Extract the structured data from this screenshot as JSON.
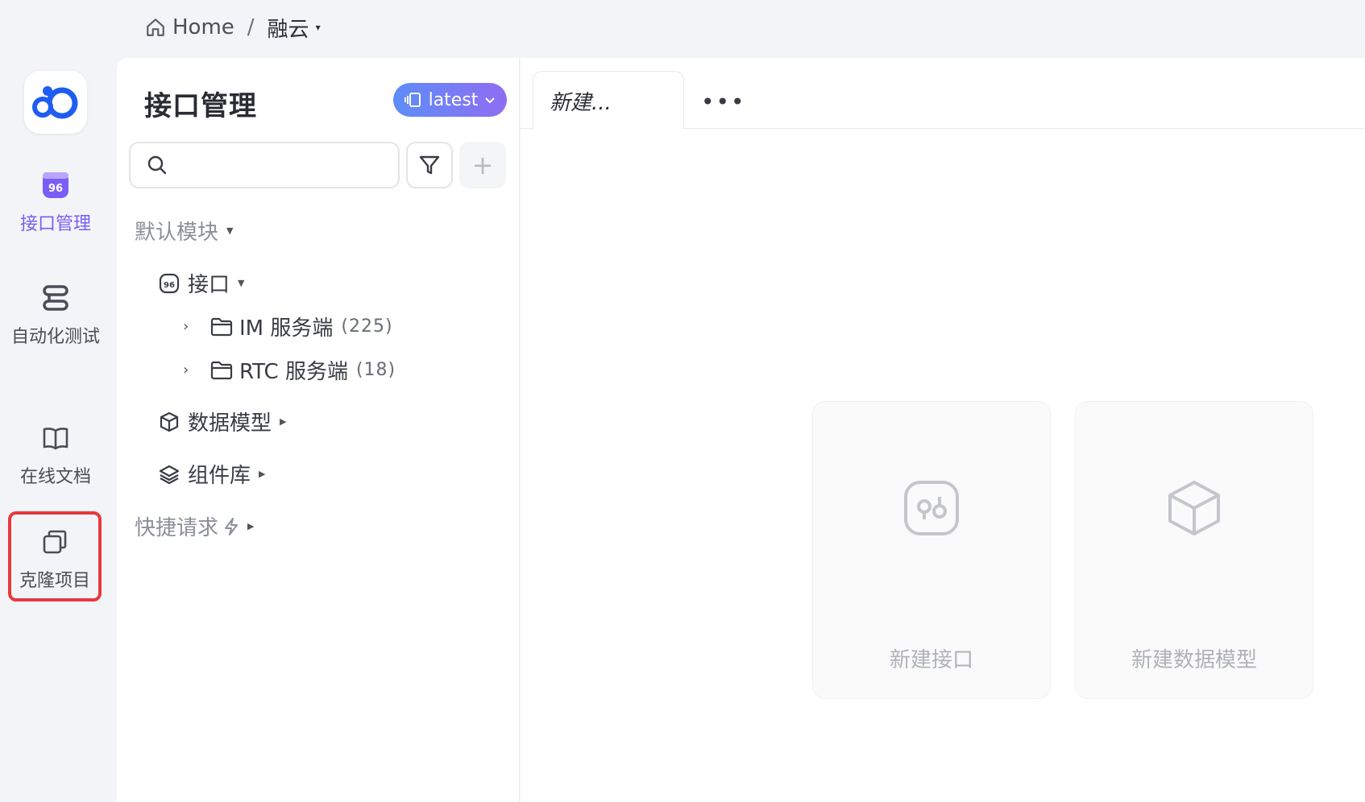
{
  "breadcrumb": {
    "home": "Home",
    "separator": "/",
    "project": "融云",
    "caret": "▾"
  },
  "rail": {
    "items": [
      {
        "label": "接口管理",
        "icon": "api-icon"
      },
      {
        "label": "自动化测试",
        "icon": "server-stack-icon"
      },
      {
        "label": "在线文档",
        "icon": "book-icon"
      },
      {
        "label": "克隆项目",
        "icon": "copy-icon"
      }
    ]
  },
  "panel": {
    "title": "接口管理",
    "version": "latest",
    "search_placeholder": "",
    "add_label": "+",
    "tree": {
      "default_module": "默认模块",
      "api": "接口",
      "folders": [
        {
          "name": "IM 服务端",
          "count": "(225)"
        },
        {
          "name": "RTC 服务端",
          "count": "(18)"
        }
      ],
      "data_model": "数据模型",
      "components": "组件库",
      "quick_request": "快捷请求"
    }
  },
  "main": {
    "tab_label": "新建...",
    "more_label": "•••",
    "cards": [
      {
        "label": "新建接口",
        "icon": "api-icon"
      },
      {
        "label": "新建数据模型",
        "icon": "cube-icon"
      }
    ]
  },
  "colors": {
    "accent": "#7a5df5",
    "highlight": "#e8383d",
    "logo": "#1f5cf0"
  }
}
